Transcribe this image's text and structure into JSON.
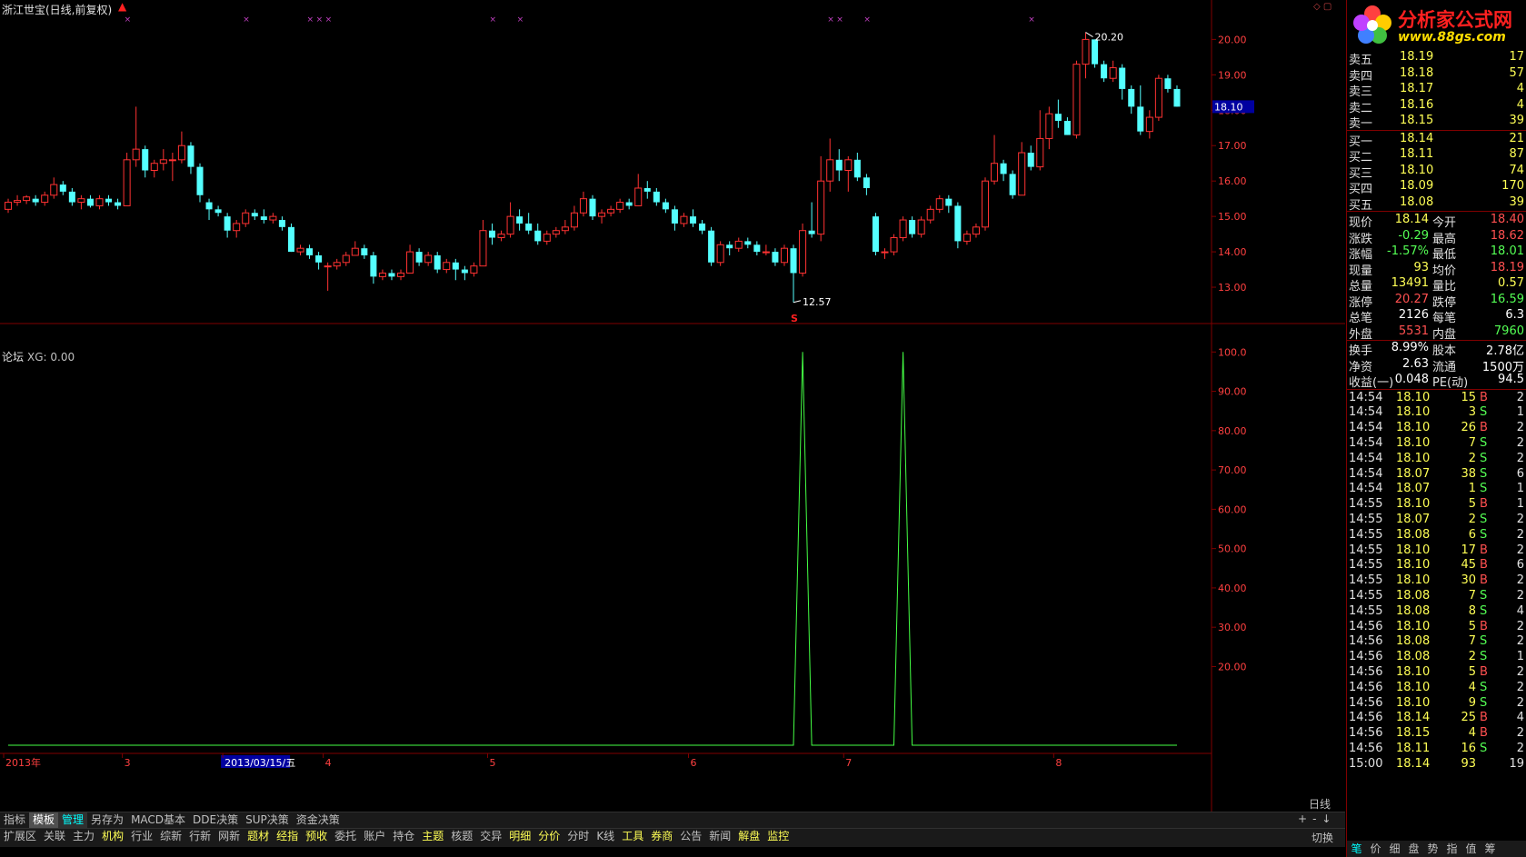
{
  "header": {
    "title": "浙江世宝(日线,前复权)",
    "sub_title": "论坛",
    "xg_label": "XG: 0.00"
  },
  "main_chart": {
    "price_axis_ticks": [
      "20.00",
      "19.00",
      "18.00",
      "17.00",
      "16.00",
      "15.00",
      "14.00",
      "13.00"
    ],
    "price_ticks_values": [
      20,
      19,
      18,
      17,
      16,
      15,
      14,
      13
    ],
    "current_price_tag": "18.10",
    "high_label": "20.20",
    "low_label": "12.57",
    "signal_mark": "S",
    "up_color": "#ff3232",
    "down_color": "#54ffff",
    "y_range": [
      12.0,
      20.6
    ]
  },
  "sub_chart": {
    "axis_ticks": [
      "100.0",
      "90.00",
      "80.00",
      "70.00",
      "60.00",
      "50.00",
      "40.00",
      "30.00",
      "20.00"
    ],
    "axis_values": [
      100,
      90,
      80,
      70,
      60,
      50,
      40,
      30,
      20
    ],
    "line_color": "#44ff44",
    "y_range": [
      0,
      104
    ]
  },
  "chart_data": {
    "type": "line",
    "title": "",
    "note_values": "Candlestick (OHLC, price) on top; XG indicator line below",
    "candles": [
      [
        15.2,
        15.5,
        15.1,
        15.4
      ],
      [
        15.4,
        15.6,
        15.3,
        15.45
      ],
      [
        15.45,
        15.6,
        15.35,
        15.55
      ],
      [
        15.5,
        15.6,
        15.3,
        15.4
      ],
      [
        15.4,
        15.7,
        15.3,
        15.6
      ],
      [
        15.6,
        16.1,
        15.5,
        15.9
      ],
      [
        15.9,
        16.0,
        15.6,
        15.7
      ],
      [
        15.7,
        15.8,
        15.3,
        15.4
      ],
      [
        15.4,
        15.6,
        15.2,
        15.5
      ],
      [
        15.5,
        15.6,
        15.25,
        15.3
      ],
      [
        15.3,
        15.6,
        15.2,
        15.5
      ],
      [
        15.5,
        15.6,
        15.3,
        15.4
      ],
      [
        15.4,
        15.5,
        15.2,
        15.3
      ],
      [
        15.3,
        16.8,
        15.3,
        16.6
      ],
      [
        16.6,
        18.1,
        16.4,
        16.9
      ],
      [
        16.9,
        17.0,
        16.1,
        16.3
      ],
      [
        16.3,
        16.6,
        16.1,
        16.5
      ],
      [
        16.5,
        16.9,
        16.3,
        16.6
      ],
      [
        16.6,
        16.8,
        16.0,
        16.6
      ],
      [
        16.6,
        17.4,
        16.5,
        17.0
      ],
      [
        17.0,
        17.1,
        16.2,
        16.4
      ],
      [
        16.4,
        16.5,
        15.4,
        15.6
      ],
      [
        15.4,
        15.5,
        14.9,
        15.2
      ],
      [
        15.2,
        15.3,
        15.0,
        15.1
      ],
      [
        15.0,
        15.1,
        14.4,
        14.6
      ],
      [
        14.6,
        14.9,
        14.4,
        14.8
      ],
      [
        14.8,
        15.2,
        14.7,
        15.1
      ],
      [
        15.1,
        15.2,
        14.9,
        15.0
      ],
      [
        15.0,
        15.2,
        14.8,
        14.9
      ],
      [
        14.9,
        15.1,
        14.8,
        15.0
      ],
      [
        14.9,
        15.0,
        14.6,
        14.7
      ],
      [
        14.7,
        14.8,
        14.0,
        14.0
      ],
      [
        14.0,
        14.2,
        13.9,
        14.1
      ],
      [
        14.1,
        14.2,
        13.8,
        13.9
      ],
      [
        13.9,
        14.0,
        13.5,
        13.7
      ],
      [
        13.6,
        13.7,
        12.9,
        13.6
      ],
      [
        13.6,
        13.8,
        13.5,
        13.7
      ],
      [
        13.7,
        14.0,
        13.6,
        13.9
      ],
      [
        13.9,
        14.3,
        13.9,
        14.1
      ],
      [
        14.1,
        14.2,
        13.8,
        13.9
      ],
      [
        13.9,
        14.0,
        13.1,
        13.3
      ],
      [
        13.3,
        13.5,
        13.2,
        13.4
      ],
      [
        13.4,
        13.5,
        13.2,
        13.3
      ],
      [
        13.3,
        13.5,
        13.2,
        13.4
      ],
      [
        13.4,
        14.2,
        13.4,
        14.0
      ],
      [
        14.0,
        14.1,
        13.6,
        13.7
      ],
      [
        13.7,
        14.0,
        13.6,
        13.9
      ],
      [
        13.9,
        14.0,
        13.4,
        13.5
      ],
      [
        13.5,
        13.8,
        13.4,
        13.7
      ],
      [
        13.7,
        13.8,
        13.2,
        13.5
      ],
      [
        13.5,
        13.6,
        13.2,
        13.4
      ],
      [
        13.4,
        13.7,
        13.3,
        13.6
      ],
      [
        13.6,
        14.9,
        13.6,
        14.6
      ],
      [
        14.6,
        14.8,
        14.2,
        14.4
      ],
      [
        14.4,
        14.6,
        14.3,
        14.5
      ],
      [
        14.5,
        15.4,
        14.4,
        15.0
      ],
      [
        15.0,
        15.2,
        14.6,
        14.8
      ],
      [
        14.8,
        15.1,
        14.5,
        14.6
      ],
      [
        14.6,
        14.8,
        14.2,
        14.3
      ],
      [
        14.3,
        14.6,
        14.2,
        14.5
      ],
      [
        14.5,
        14.7,
        14.4,
        14.6
      ],
      [
        14.6,
        14.9,
        14.5,
        14.7
      ],
      [
        14.7,
        15.3,
        14.6,
        15.1
      ],
      [
        15.1,
        15.7,
        15.0,
        15.5
      ],
      [
        15.5,
        15.6,
        14.9,
        15.0
      ],
      [
        15.0,
        15.2,
        14.8,
        15.1
      ],
      [
        15.1,
        15.3,
        15.0,
        15.2
      ],
      [
        15.2,
        15.5,
        15.1,
        15.4
      ],
      [
        15.4,
        15.5,
        15.2,
        15.3
      ],
      [
        15.3,
        16.2,
        15.3,
        15.8
      ],
      [
        15.8,
        16.0,
        15.5,
        15.7
      ],
      [
        15.7,
        15.8,
        15.3,
        15.4
      ],
      [
        15.4,
        15.5,
        15.1,
        15.2
      ],
      [
        15.2,
        15.3,
        14.6,
        14.8
      ],
      [
        14.8,
        15.1,
        14.7,
        15.0
      ],
      [
        15.0,
        15.2,
        14.7,
        14.8
      ],
      [
        14.8,
        14.9,
        14.5,
        14.6
      ],
      [
        14.6,
        14.7,
        13.6,
        13.7
      ],
      [
        13.7,
        14.3,
        13.6,
        14.2
      ],
      [
        14.2,
        14.3,
        13.9,
        14.1
      ],
      [
        14.1,
        14.4,
        14.0,
        14.3
      ],
      [
        14.3,
        14.4,
        14.1,
        14.2
      ],
      [
        14.2,
        14.3,
        13.9,
        14.0
      ],
      [
        14.0,
        14.2,
        13.9,
        14.0
      ],
      [
        14.0,
        14.1,
        13.6,
        13.7
      ],
      [
        13.7,
        14.2,
        13.6,
        14.1
      ],
      [
        14.1,
        14.2,
        12.57,
        13.4
      ],
      [
        13.4,
        14.8,
        13.3,
        14.6
      ],
      [
        14.6,
        15.4,
        14.4,
        14.5
      ],
      [
        14.5,
        16.7,
        14.3,
        16.0
      ],
      [
        16.0,
        17.2,
        15.7,
        16.6
      ],
      [
        16.6,
        16.9,
        16.0,
        16.3
      ],
      [
        16.3,
        16.7,
        15.7,
        16.6
      ],
      [
        16.6,
        16.8,
        16.0,
        16.1
      ],
      [
        16.1,
        16.2,
        15.6,
        15.8
      ],
      [
        15.0,
        15.1,
        13.9,
        14.0
      ],
      [
        14.0,
        14.1,
        13.8,
        14.0
      ],
      [
        14.0,
        14.5,
        13.9,
        14.4
      ],
      [
        14.4,
        15.0,
        14.3,
        14.9
      ],
      [
        14.9,
        15.0,
        14.4,
        14.5
      ],
      [
        14.5,
        15.0,
        14.4,
        14.9
      ],
      [
        14.9,
        15.3,
        14.8,
        15.2
      ],
      [
        15.2,
        15.6,
        15.1,
        15.5
      ],
      [
        15.5,
        15.6,
        15.1,
        15.3
      ],
      [
        15.3,
        15.4,
        14.1,
        14.3
      ],
      [
        14.3,
        14.6,
        14.2,
        14.5
      ],
      [
        14.5,
        14.8,
        14.4,
        14.7
      ],
      [
        14.7,
        16.1,
        14.6,
        16.0
      ],
      [
        16.0,
        17.3,
        15.9,
        16.5
      ],
      [
        16.5,
        16.6,
        16.0,
        16.2
      ],
      [
        16.2,
        16.3,
        15.5,
        15.6
      ],
      [
        15.6,
        17.1,
        15.6,
        16.8
      ],
      [
        16.8,
        17.0,
        16.3,
        16.4
      ],
      [
        16.4,
        18.0,
        16.3,
        17.2
      ],
      [
        17.2,
        18.1,
        16.9,
        17.9
      ],
      [
        17.9,
        18.3,
        17.5,
        17.7
      ],
      [
        17.7,
        17.8,
        17.3,
        17.3
      ],
      [
        17.3,
        19.4,
        17.2,
        19.3
      ],
      [
        19.3,
        20.2,
        18.9,
        20.0
      ],
      [
        20.0,
        20.0,
        19.2,
        19.3
      ],
      [
        19.3,
        19.4,
        18.8,
        18.9
      ],
      [
        18.9,
        19.4,
        18.8,
        19.2
      ],
      [
        19.2,
        19.3,
        18.3,
        18.6
      ],
      [
        18.6,
        18.7,
        17.9,
        18.1
      ],
      [
        18.1,
        18.7,
        17.3,
        17.4
      ],
      [
        17.4,
        18.0,
        17.2,
        17.8
      ],
      [
        17.8,
        19.0,
        17.7,
        18.9
      ],
      [
        18.9,
        19.0,
        18.5,
        18.6
      ],
      [
        18.6,
        18.7,
        18.1,
        18.1
      ]
    ],
    "xg_series": [
      0,
      0,
      0,
      0,
      0,
      0,
      0,
      0,
      0,
      0,
      0,
      0,
      0,
      0,
      0,
      0,
      0,
      0,
      0,
      0,
      0,
      0,
      0,
      0,
      0,
      0,
      0,
      0,
      0,
      0,
      0,
      0,
      0,
      0,
      0,
      0,
      0,
      0,
      0,
      0,
      0,
      0,
      0,
      0,
      0,
      0,
      0,
      0,
      0,
      0,
      0,
      0,
      0,
      0,
      0,
      0,
      0,
      0,
      0,
      0,
      0,
      0,
      0,
      0,
      0,
      0,
      0,
      0,
      0,
      0,
      0,
      0,
      0,
      0,
      0,
      0,
      0,
      0,
      0,
      0,
      0,
      0,
      0,
      0,
      0,
      0,
      0,
      100,
      0,
      0,
      0,
      0,
      0,
      0,
      0,
      0,
      0,
      0,
      100,
      0,
      0,
      0,
      0,
      0,
      0,
      0,
      0,
      0,
      0,
      0,
      0,
      0,
      0,
      0,
      0,
      0,
      0,
      0,
      0,
      0,
      0,
      0,
      0,
      0,
      0,
      0,
      0,
      0,
      0
    ],
    "xlabel_ticks": [
      "2013年",
      "3",
      "2013/03/15/五",
      "4",
      "5",
      "6",
      "7",
      "8"
    ],
    "xlabel_tick_index": [
      0,
      13,
      24,
      35,
      53,
      75,
      92,
      115
    ],
    "ylim_price": [
      12.0,
      20.6
    ],
    "ylim_xg": [
      0,
      104
    ]
  },
  "toolbar1": [
    "指标",
    "模板",
    "管理",
    "另存为",
    "MACD基本",
    "DDE决策",
    "SUP决策",
    "资金决策"
  ],
  "toolbar2": [
    "扩展区",
    "关联",
    "主力",
    "机构",
    "行业",
    "综新",
    "行新",
    "网新",
    "题材",
    "经指",
    "预收",
    "委托",
    "账户",
    "持仓",
    "主题",
    "核题",
    "交异",
    "明细",
    "分价",
    "分时",
    "K线",
    "工具",
    "券商",
    "公告",
    "新闻",
    "解盘",
    "监控"
  ],
  "toolbar2_yellow": [
    3,
    8,
    9,
    10,
    14,
    17,
    18,
    21,
    22,
    25,
    26
  ],
  "period_label": "日线",
  "zoom_controls": [
    "+",
    "-",
    "↓"
  ],
  "switch_label": "切换",
  "logo": {
    "name": "分析家公式网",
    "url": "www.88gs.com"
  },
  "quotes": {
    "sell": [
      {
        "label": "卖五",
        "price": "18.19",
        "vol": "17"
      },
      {
        "label": "卖四",
        "price": "18.18",
        "vol": "57"
      },
      {
        "label": "卖三",
        "price": "18.17",
        "vol": "4"
      },
      {
        "label": "卖二",
        "price": "18.16",
        "vol": "4"
      },
      {
        "label": "卖一",
        "price": "18.15",
        "vol": "39"
      }
    ],
    "buy": [
      {
        "label": "买一",
        "price": "18.14",
        "vol": "21"
      },
      {
        "label": "买二",
        "price": "18.11",
        "vol": "87"
      },
      {
        "label": "买三",
        "price": "18.10",
        "vol": "74"
      },
      {
        "label": "买四",
        "price": "18.09",
        "vol": "170"
      },
      {
        "label": "买五",
        "price": "18.08",
        "vol": "39"
      }
    ],
    "stats": [
      {
        "l1": "现价",
        "v1": "18.14",
        "c1": "#ffff55",
        "l2": "今开",
        "v2": "18.40",
        "c2": "#ff5050"
      },
      {
        "l1": "涨跌",
        "v1": "-0.29",
        "c1": "#54ff54",
        "l2": "最高",
        "v2": "18.62",
        "c2": "#ff5050"
      },
      {
        "l1": "涨幅",
        "v1": "-1.57%",
        "c1": "#54ff54",
        "l2": "最低",
        "v2": "18.01",
        "c2": "#54ff54"
      },
      {
        "l1": "现量",
        "v1": "93",
        "c1": "#ffff55",
        "l2": "均价",
        "v2": "18.19",
        "c2": "#ff5050"
      },
      {
        "l1": "总量",
        "v1": "13491",
        "c1": "#ffff55",
        "l2": "量比",
        "v2": "0.57",
        "c2": "#ffff55"
      },
      {
        "l1": "涨停",
        "v1": "20.27",
        "c1": "#ff5050",
        "l2": "跌停",
        "v2": "16.59",
        "c2": "#54ff54"
      },
      {
        "l1": "总笔",
        "v1": "2126",
        "c1": "#ffffff",
        "l2": "每笔",
        "v2": "6.3",
        "c2": "#ffffff"
      },
      {
        "l1": "外盘",
        "v1": "5531",
        "c1": "#ff5050",
        "l2": "内盘",
        "v2": "7960",
        "c2": "#54ff54"
      },
      {
        "l1": "换手",
        "v1": "8.99%",
        "c1": "#ffffff",
        "l2": "股本",
        "v2": "2.78亿",
        "c2": "#ffffff"
      },
      {
        "l1": "净资",
        "v1": "2.63",
        "c1": "#ffffff",
        "l2": "流通",
        "v2": "1500万",
        "c2": "#ffffff"
      },
      {
        "l1": "收益(一)",
        "v1": "0.048",
        "c1": "#ffffff",
        "l2": "PE(动)",
        "v2": "94.5",
        "c2": "#ffffff"
      }
    ]
  },
  "trades": [
    {
      "t": "14:54",
      "p": "18.10",
      "v": "15",
      "bs": "B",
      "n": "2"
    },
    {
      "t": "14:54",
      "p": "18.10",
      "v": "3",
      "bs": "S",
      "n": "1"
    },
    {
      "t": "14:54",
      "p": "18.10",
      "v": "26",
      "bs": "B",
      "n": "2"
    },
    {
      "t": "14:54",
      "p": "18.10",
      "v": "7",
      "bs": "S",
      "n": "2"
    },
    {
      "t": "14:54",
      "p": "18.10",
      "v": "2",
      "bs": "S",
      "n": "2"
    },
    {
      "t": "14:54",
      "p": "18.07",
      "v": "38",
      "bs": "S",
      "n": "6"
    },
    {
      "t": "14:54",
      "p": "18.07",
      "v": "1",
      "bs": "S",
      "n": "1"
    },
    {
      "t": "14:55",
      "p": "18.10",
      "v": "5",
      "bs": "B",
      "n": "1"
    },
    {
      "t": "14:55",
      "p": "18.07",
      "v": "2",
      "bs": "S",
      "n": "2"
    },
    {
      "t": "14:55",
      "p": "18.08",
      "v": "6",
      "bs": "S",
      "n": "2"
    },
    {
      "t": "14:55",
      "p": "18.10",
      "v": "17",
      "bs": "B",
      "n": "2"
    },
    {
      "t": "14:55",
      "p": "18.10",
      "v": "45",
      "bs": "B",
      "n": "6"
    },
    {
      "t": "14:55",
      "p": "18.10",
      "v": "30",
      "bs": "B",
      "n": "2"
    },
    {
      "t": "14:55",
      "p": "18.08",
      "v": "7",
      "bs": "S",
      "n": "2"
    },
    {
      "t": "14:55",
      "p": "18.08",
      "v": "8",
      "bs": "S",
      "n": "4"
    },
    {
      "t": "14:56",
      "p": "18.10",
      "v": "5",
      "bs": "B",
      "n": "2"
    },
    {
      "t": "14:56",
      "p": "18.08",
      "v": "7",
      "bs": "S",
      "n": "2"
    },
    {
      "t": "14:56",
      "p": "18.08",
      "v": "2",
      "bs": "S",
      "n": "1"
    },
    {
      "t": "14:56",
      "p": "18.10",
      "v": "5",
      "bs": "B",
      "n": "2"
    },
    {
      "t": "14:56",
      "p": "18.10",
      "v": "4",
      "bs": "S",
      "n": "2"
    },
    {
      "t": "14:56",
      "p": "18.10",
      "v": "9",
      "bs": "S",
      "n": "2"
    },
    {
      "t": "14:56",
      "p": "18.14",
      "v": "25",
      "bs": "B",
      "n": "4"
    },
    {
      "t": "14:56",
      "p": "18.15",
      "v": "4",
      "bs": "B",
      "n": "2"
    },
    {
      "t": "14:56",
      "p": "18.11",
      "v": "16",
      "bs": "S",
      "n": "2"
    },
    {
      "t": "15:00",
      "p": "18.14",
      "v": "93",
      "bs": "",
      "n": "19"
    }
  ],
  "right_tabs": [
    "笔",
    "价",
    "细",
    "盘",
    "势",
    "指",
    "值",
    "筹"
  ]
}
